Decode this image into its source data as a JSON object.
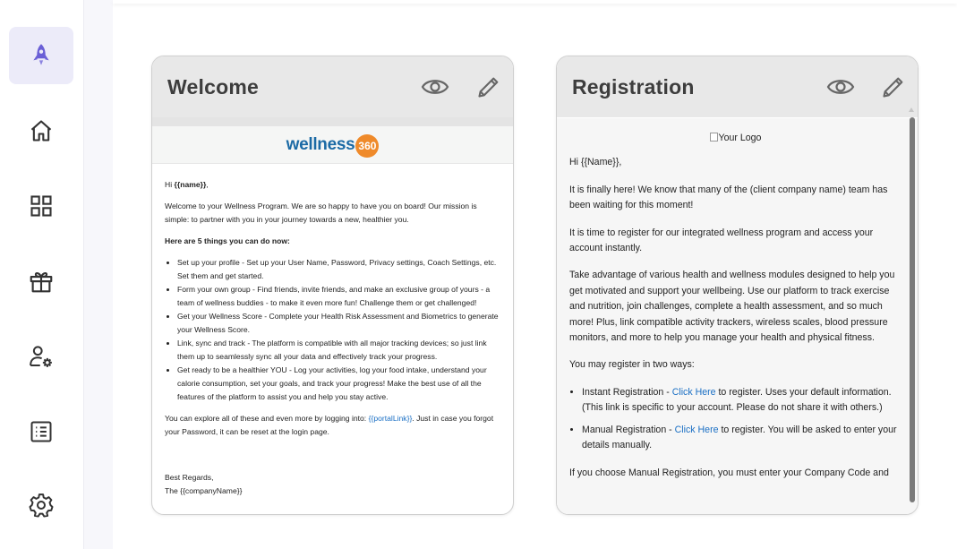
{
  "nav": {
    "items": [
      {
        "icon": "rocket-icon",
        "active": true
      },
      {
        "icon": "home-icon"
      },
      {
        "icon": "dashboard-grid-icon"
      },
      {
        "icon": "gift-icon"
      },
      {
        "icon": "user-settings-icon"
      },
      {
        "icon": "list-icon"
      },
      {
        "icon": "gear-icon"
      }
    ]
  },
  "colors": {
    "accent": "#6a5fd6",
    "active_bg": "#ecebf9",
    "link": "#1a6fc4",
    "logo_blue": "#1b6aa5",
    "logo_orange": "#ef8a2a"
  },
  "welcome": {
    "title": "Welcome",
    "logo": {
      "text": "wellness",
      "number": "360"
    },
    "greeting_prefix": "Hi ",
    "greeting_var": "{{name}}",
    "greeting_suffix": ",",
    "intro": "Welcome to your Wellness Program. We are so happy to have you on board! Our mission is simple: to partner with you in your journey towards a new, healthier you.",
    "list_heading": "Here are 5 things you can do now:",
    "items": [
      "Set up your profile - Set up your User Name, Password, Privacy settings, Coach Settings, etc. Set them and get started.",
      "Form your own group - Find friends, invite friends, and make an exclusive group of yours - a team of wellness buddies - to make it even more fun! Challenge them or get challenged!",
      "Get your Wellness Score - Complete your Health Risk Assessment and Biometrics to generate your Wellness Score.",
      "Link, sync and track - The platform is compatible with all major tracking devices; so just link them up to seamlessly sync all your data and effectively track your progress.",
      "Get ready to be a healthier YOU - Log your activities, log your food intake, understand your calorie consumption, set your goals, and track your progress! Make the best use of all the features of the platform to assist you and help you stay active."
    ],
    "explore_before": "You can explore all of these and even more by logging into: ",
    "explore_link": "{{portalLink}}",
    "explore_after": ". Just in case you forgot your Password, it can be reset at the login page.",
    "regards": "Best Regards,",
    "signature": "The {{companyName}}"
  },
  "registration": {
    "title": "Registration",
    "logo_alt": "Your Logo",
    "greeting": "Hi {{Name}},",
    "p1": "It is finally here! We know that many of the (client company name) team has been waiting for this moment!",
    "p2": "It is time to register for our integrated wellness program and access your account instantly.",
    "p3": "Take advantage of various health and wellness modules designed to help you get motivated and support your wellbeing. Use our platform to track exercise and nutrition, join challenges, complete a health assessment, and so much more! Plus, link compatible activity trackers, wireless scales, blood pressure monitors, and more to help you manage your health and physical fitness.",
    "p4": "You may register in two ways:",
    "instant_prefix": "Instant Registration - ",
    "instant_link": "Click Here",
    "instant_suffix": " to register. Uses your default information. (This link is specific to your account. Please do not share it with others.)",
    "manual_prefix": "Manual Registration - ",
    "manual_link": "Click Here",
    "manual_suffix": " to register. You will be asked to enter your details manually.",
    "p5": "If you choose Manual Registration, you must enter your Company Code and"
  }
}
